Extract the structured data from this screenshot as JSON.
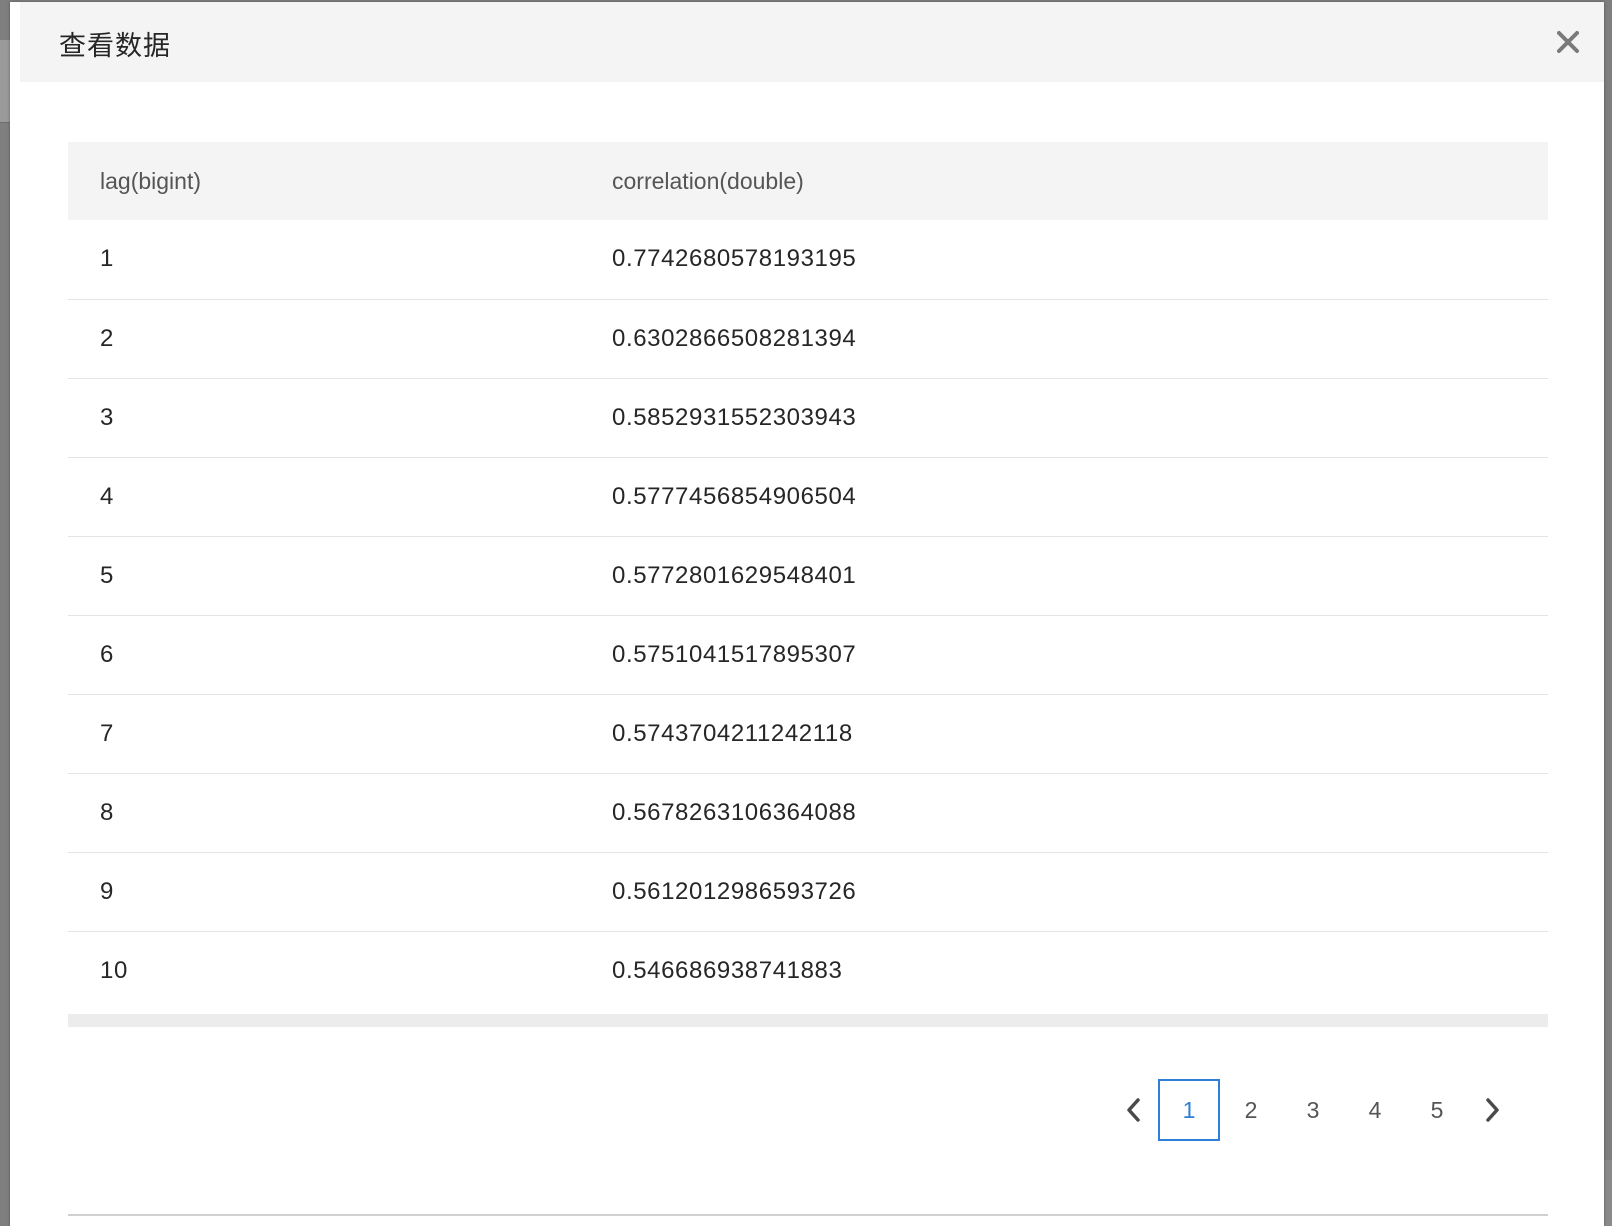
{
  "modal": {
    "title": "查看数据",
    "close_icon": "close-icon"
  },
  "table": {
    "columns": [
      "lag(bigint)",
      "correlation(double)"
    ],
    "rows": [
      [
        "1",
        "0.7742680578193195"
      ],
      [
        "2",
        "0.6302866508281394"
      ],
      [
        "3",
        "0.5852931552303943"
      ],
      [
        "4",
        "0.5777456854906504"
      ],
      [
        "5",
        "0.5772801629548401"
      ],
      [
        "6",
        "0.5751041517895307"
      ],
      [
        "7",
        "0.5743704211242118"
      ],
      [
        "8",
        "0.5678263106364088"
      ],
      [
        "9",
        "0.5612012986593726"
      ],
      [
        "10",
        "0.546686938741883"
      ]
    ]
  },
  "pagination": {
    "pages": [
      "1",
      "2",
      "3",
      "4",
      "5"
    ],
    "current_page": "1",
    "prev_icon": "chevron-left-icon",
    "next_icon": "chevron-right-icon",
    "active_color": "#2d7fd8"
  }
}
